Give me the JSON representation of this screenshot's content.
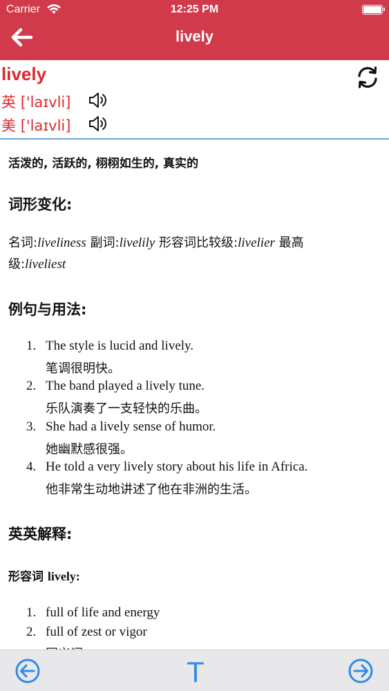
{
  "status_bar": {
    "carrier": "Carrier",
    "time": "12:25 PM"
  },
  "nav": {
    "title": "lively"
  },
  "word": {
    "headword": "lively",
    "uk": {
      "label": "英",
      "phonetic": "['laɪvli]"
    },
    "us": {
      "label": "美",
      "phonetic": "['laɪvli]"
    }
  },
  "meaning": "活泼的, 活跃的, 栩栩如生的, 真实的",
  "forms": {
    "heading": "词形变化:",
    "noun_label": "名词:",
    "noun": "liveliness",
    "adv_label": "副词:",
    "adv": "livelily",
    "comp_label": "形容词比较级:",
    "comp": "livelier",
    "sup_label_1": "最高",
    "sup_label_2": "级:",
    "sup": "liveliest"
  },
  "examples": {
    "heading": "例句与用法:",
    "items": [
      {
        "num": "1.",
        "en": "The style is lucid and lively.",
        "cn": "笔调很明快。"
      },
      {
        "num": "2.",
        "en": "The band played a lively tune.",
        "cn": "乐队演奏了一支轻快的乐曲。"
      },
      {
        "num": "3.",
        "en": "She had a lively sense of humor.",
        "cn": "她幽默感很强。"
      },
      {
        "num": "4.",
        "en": "He told a very lively story about his life in Africa.",
        "cn": "他非常生动地讲述了他在非洲的生活。"
      }
    ]
  },
  "english": {
    "heading": "英英解释:",
    "pos_label": "形容词",
    "pos_word": "lively:",
    "items": [
      {
        "num": "1.",
        "text": "full of life and energy"
      },
      {
        "num": "2.",
        "text": "full of zest or vigor"
      }
    ],
    "partial": "同义词:"
  },
  "toolbar": {
    "text_button": "T"
  },
  "colors": {
    "header": "#d03a4a",
    "accent_red": "#e0272e",
    "accent_blue": "#2f8be8",
    "toolbar_bg": "#e8e8ea"
  },
  "icons": [
    "wifi-icon",
    "battery-icon",
    "back-arrow-icon",
    "refresh-icon",
    "speaker-icon",
    "prev-circle-icon",
    "text-size-icon",
    "next-circle-icon"
  ]
}
